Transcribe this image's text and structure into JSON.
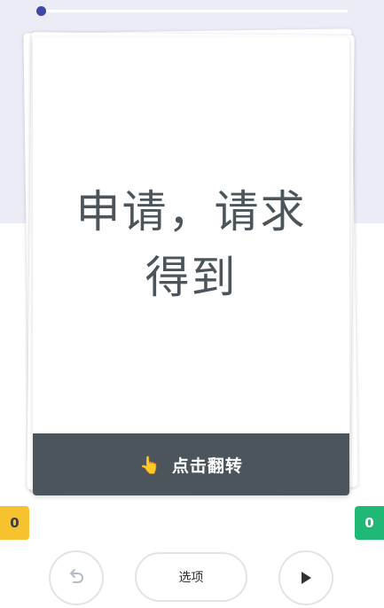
{
  "progress": {
    "value": 0.02
  },
  "card": {
    "word_line1": "申请，请求",
    "word_line2": "得到",
    "flip_label": "点击翻转",
    "flip_icon": "pointing-hand-icon"
  },
  "counters": {
    "left": "0",
    "right": "0"
  },
  "controls": {
    "undo_icon": "undo-icon",
    "options_label": "选项",
    "play_icon": "play-icon"
  },
  "colors": {
    "accent": "#3f48a8",
    "card_text": "#4b555b",
    "flip_bar": "#4b555b",
    "left_counter": "#f6c32f",
    "right_counter": "#1fb877",
    "top_background": "#ececf7"
  }
}
